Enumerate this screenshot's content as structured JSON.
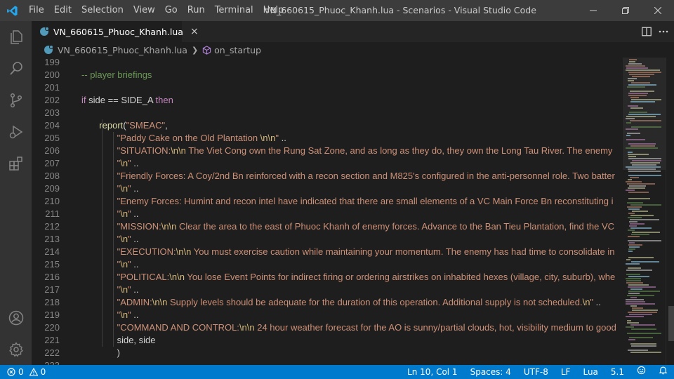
{
  "window": {
    "title": "VN_660615_Phuoc_Khanh.lua - Scenarios - Visual Studio Code",
    "menu": [
      "File",
      "Edit",
      "Selection",
      "View",
      "Go",
      "Run",
      "Terminal",
      "Help"
    ]
  },
  "activity_bar": {
    "icons": [
      "explorer-icon",
      "search-icon",
      "source-control-icon",
      "run-debug-icon",
      "extensions-icon"
    ],
    "bottom_icons": [
      "account-icon",
      "settings-gear-icon"
    ]
  },
  "tab": {
    "label": "VN_660615_Phuoc_Khanh.lua",
    "close": "×"
  },
  "breadcrumbs": {
    "file": "VN_660615_Phuoc_Khanh.lua",
    "symbol": "on_startup"
  },
  "editor": {
    "lines": [
      {
        "n": "199",
        "t": []
      },
      {
        "n": "200",
        "t": [
          {
            "c": "tk-comment",
            "s": "-- player briefings"
          }
        ]
      },
      {
        "n": "201",
        "t": []
      },
      {
        "n": "202",
        "t": [
          {
            "c": "tk-kw",
            "s": "if"
          },
          {
            "c": "tk-id",
            "s": " side == SIDE_A "
          },
          {
            "c": "tk-kw",
            "s": "then"
          }
        ]
      },
      {
        "n": "203",
        "t": []
      },
      {
        "n": "204",
        "t": [
          {
            "c": "tk-ws",
            "s": "       "
          },
          {
            "c": "tk-fn",
            "s": "report"
          },
          {
            "c": "tk-id",
            "s": "("
          },
          {
            "c": "tk-str",
            "s": "\"SMEAC\""
          },
          {
            "c": "tk-id",
            "s": ","
          }
        ]
      },
      {
        "n": "205",
        "t": [
          {
            "c": "tk-ws",
            "s": "              "
          },
          {
            "c": "tk-str",
            "s": "\"Paddy Cake on the Old Plantation "
          },
          {
            "c": "tk-esc",
            "s": "\\n\\n"
          },
          {
            "c": "tk-str",
            "s": "\""
          },
          {
            "c": "tk-id",
            "s": " .."
          }
        ]
      },
      {
        "n": "206",
        "t": [
          {
            "c": "tk-ws",
            "s": "              "
          },
          {
            "c": "tk-str",
            "s": "\"SITUATION:"
          },
          {
            "c": "tk-esc",
            "s": "\\n\\n"
          },
          {
            "c": "tk-str",
            "s": " The Viet Cong own the Rung Sat Zone, and as long as they do, they own the Long Tau River. The enemy"
          }
        ]
      },
      {
        "n": "207",
        "t": [
          {
            "c": "tk-ws",
            "s": "              "
          },
          {
            "c": "tk-str",
            "s": "\""
          },
          {
            "c": "tk-esc",
            "s": "\\n"
          },
          {
            "c": "tk-str",
            "s": "\""
          },
          {
            "c": "tk-id",
            "s": " .."
          }
        ]
      },
      {
        "n": "208",
        "t": [
          {
            "c": "tk-ws",
            "s": "              "
          },
          {
            "c": "tk-str",
            "s": "\"Friendly Forces: A Coy/2nd Bn reinforced with a recon section and M825's configured in the anti-personnel role. Two batter"
          }
        ]
      },
      {
        "n": "209",
        "t": [
          {
            "c": "tk-ws",
            "s": "              "
          },
          {
            "c": "tk-str",
            "s": "\""
          },
          {
            "c": "tk-esc",
            "s": "\\n"
          },
          {
            "c": "tk-str",
            "s": "\""
          },
          {
            "c": "tk-id",
            "s": " .."
          }
        ]
      },
      {
        "n": "210",
        "t": [
          {
            "c": "tk-ws",
            "s": "              "
          },
          {
            "c": "tk-str",
            "s": "\"Enemy Forces: Humint and recon intel have indicated that there are small elements of a VC Main Force Bn reconstituting i"
          }
        ]
      },
      {
        "n": "211",
        "t": [
          {
            "c": "tk-ws",
            "s": "              "
          },
          {
            "c": "tk-str",
            "s": "\""
          },
          {
            "c": "tk-esc",
            "s": "\\n"
          },
          {
            "c": "tk-str",
            "s": "\""
          },
          {
            "c": "tk-id",
            "s": " .."
          }
        ]
      },
      {
        "n": "212",
        "t": [
          {
            "c": "tk-ws",
            "s": "              "
          },
          {
            "c": "tk-str",
            "s": "\"MISSION:"
          },
          {
            "c": "tk-esc",
            "s": "\\n\\n"
          },
          {
            "c": "tk-str",
            "s": " Clear the area to the east of Phuoc Khanh of enemy forces. Advance to the Ban Tieu Plantation, find the VC"
          }
        ]
      },
      {
        "n": "213",
        "t": [
          {
            "c": "tk-ws",
            "s": "              "
          },
          {
            "c": "tk-str",
            "s": "\""
          },
          {
            "c": "tk-esc",
            "s": "\\n"
          },
          {
            "c": "tk-str",
            "s": "\""
          },
          {
            "c": "tk-id",
            "s": " .."
          }
        ]
      },
      {
        "n": "214",
        "t": [
          {
            "c": "tk-ws",
            "s": "              "
          },
          {
            "c": "tk-str",
            "s": "\"EXECUTION:"
          },
          {
            "c": "tk-esc",
            "s": "\\n\\n"
          },
          {
            "c": "tk-str",
            "s": " You must exercise caution while maintaining your momentum. The enemy has had time to consolidate in"
          }
        ]
      },
      {
        "n": "215",
        "t": [
          {
            "c": "tk-ws",
            "s": "              "
          },
          {
            "c": "tk-str",
            "s": "\""
          },
          {
            "c": "tk-esc",
            "s": "\\n"
          },
          {
            "c": "tk-str",
            "s": "\""
          },
          {
            "c": "tk-id",
            "s": " .."
          }
        ]
      },
      {
        "n": "216",
        "t": [
          {
            "c": "tk-ws",
            "s": "              "
          },
          {
            "c": "tk-str",
            "s": "\"POLITICAL:"
          },
          {
            "c": "tk-esc",
            "s": "\\n\\n"
          },
          {
            "c": "tk-str",
            "s": " You lose Event Points for indirect firing or ordering airstrikes on inhabited hexes (village, city, suburb), whe"
          }
        ]
      },
      {
        "n": "217",
        "t": [
          {
            "c": "tk-ws",
            "s": "              "
          },
          {
            "c": "tk-str",
            "s": "\""
          },
          {
            "c": "tk-esc",
            "s": "\\n"
          },
          {
            "c": "tk-str",
            "s": "\""
          },
          {
            "c": "tk-id",
            "s": " .."
          }
        ]
      },
      {
        "n": "218",
        "t": [
          {
            "c": "tk-ws",
            "s": "              "
          },
          {
            "c": "tk-str",
            "s": "\"ADMIN:"
          },
          {
            "c": "tk-esc",
            "s": "\\n\\n"
          },
          {
            "c": "tk-str",
            "s": " Supply levels should be adequate for the duration of this operation. Additional supply is not scheduled."
          },
          {
            "c": "tk-esc",
            "s": "\\n"
          },
          {
            "c": "tk-str",
            "s": "\""
          },
          {
            "c": "tk-id",
            "s": " .."
          }
        ]
      },
      {
        "n": "219",
        "t": [
          {
            "c": "tk-ws",
            "s": "              "
          },
          {
            "c": "tk-str",
            "s": "\""
          },
          {
            "c": "tk-esc",
            "s": "\\n"
          },
          {
            "c": "tk-str",
            "s": "\""
          },
          {
            "c": "tk-id",
            "s": " .."
          }
        ]
      },
      {
        "n": "220",
        "t": [
          {
            "c": "tk-ws",
            "s": "              "
          },
          {
            "c": "tk-str",
            "s": "\"COMMAND AND CONTROL:"
          },
          {
            "c": "tk-esc",
            "s": "\\n\\n"
          },
          {
            "c": "tk-str",
            "s": " 24 hour weather forecast for the AO is sunny/partial clouds, hot, visibility medium to good"
          }
        ]
      },
      {
        "n": "221",
        "t": [
          {
            "c": "tk-ws",
            "s": "              "
          },
          {
            "c": "tk-id",
            "s": "side, side"
          }
        ]
      },
      {
        "n": "222",
        "t": [
          {
            "c": "tk-ws",
            "s": "              "
          },
          {
            "c": "tk-id",
            "s": ")"
          }
        ]
      },
      {
        "n": "223",
        "t": []
      }
    ]
  },
  "status_bar": {
    "errors": "0",
    "warnings": "0",
    "position": "Ln 10, Col 1",
    "spaces": "Spaces: 4",
    "encoding": "UTF-8",
    "eol": "LF",
    "language": "Lua",
    "version": "5.1"
  },
  "colors": {
    "accent": "#007acc",
    "comment": "#6a9955",
    "keyword": "#c586c0",
    "string": "#ce9178",
    "escape": "#d7ba7d",
    "function": "#dcdcaa"
  }
}
